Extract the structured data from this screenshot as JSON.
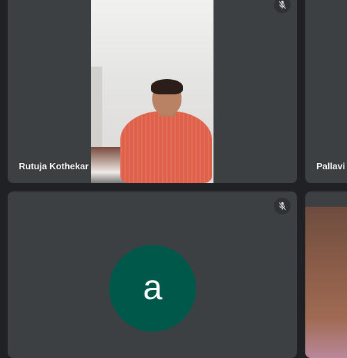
{
  "participants": [
    {
      "name": "Rutuja Kothekar",
      "muted": true,
      "mic_icon": "mic-off-icon"
    },
    {
      "name": "Pallavi",
      "muted": false
    },
    {
      "name": "",
      "avatar_letter": "a",
      "avatar_color": "#00584a",
      "muted": true,
      "mic_icon": "mic-off-icon"
    },
    {
      "name": ""
    }
  ],
  "colors": {
    "background": "#202124",
    "tile": "#3c4043",
    "mic_button": "#2f3134"
  }
}
